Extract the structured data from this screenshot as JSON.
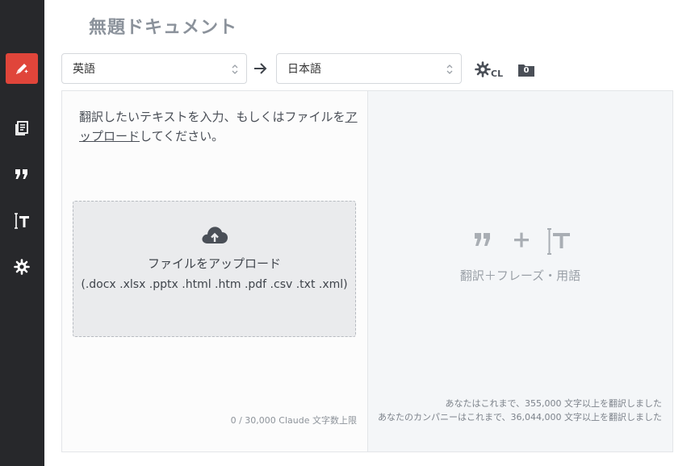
{
  "document": {
    "title": "無題ドキュメント"
  },
  "sidebar": {
    "items": [
      {
        "name": "translate",
        "icon": "pen-sparkle-icon",
        "active": true
      },
      {
        "name": "documents",
        "icon": "documents-icon"
      },
      {
        "name": "phrases",
        "icon": "quote-icon"
      },
      {
        "name": "glossary",
        "icon": "text-cursor-icon"
      },
      {
        "name": "settings",
        "icon": "gear-icon"
      }
    ]
  },
  "languages": {
    "source": "英語",
    "target": "日本語"
  },
  "toolbar": {
    "cl_label": "CL",
    "folder_count": "0"
  },
  "input": {
    "prompt_before": "翻訳したいテキストを入力、もしくはファイルを",
    "upload_link": "アップロード",
    "prompt_after": "してください。",
    "dropzone_title": "ファイルをアップロード",
    "dropzone_types": "(.docx .xlsx .pptx .html .htm .pdf .csv .txt .xml)",
    "char_count": "0 / 30,000 Claude 文字数上限"
  },
  "output": {
    "features_caption": "翻訳＋フレーズ・用語",
    "stat_personal": "あなたはこれまで、355,000 文字以上を翻訳しました",
    "stat_company": "あなたのカンパニーはこれまで、36,044,000 文字以上を翻訳しました"
  },
  "colors": {
    "accent": "#e0453a",
    "sidebar": "#27282b",
    "muted": "#8b929b"
  }
}
